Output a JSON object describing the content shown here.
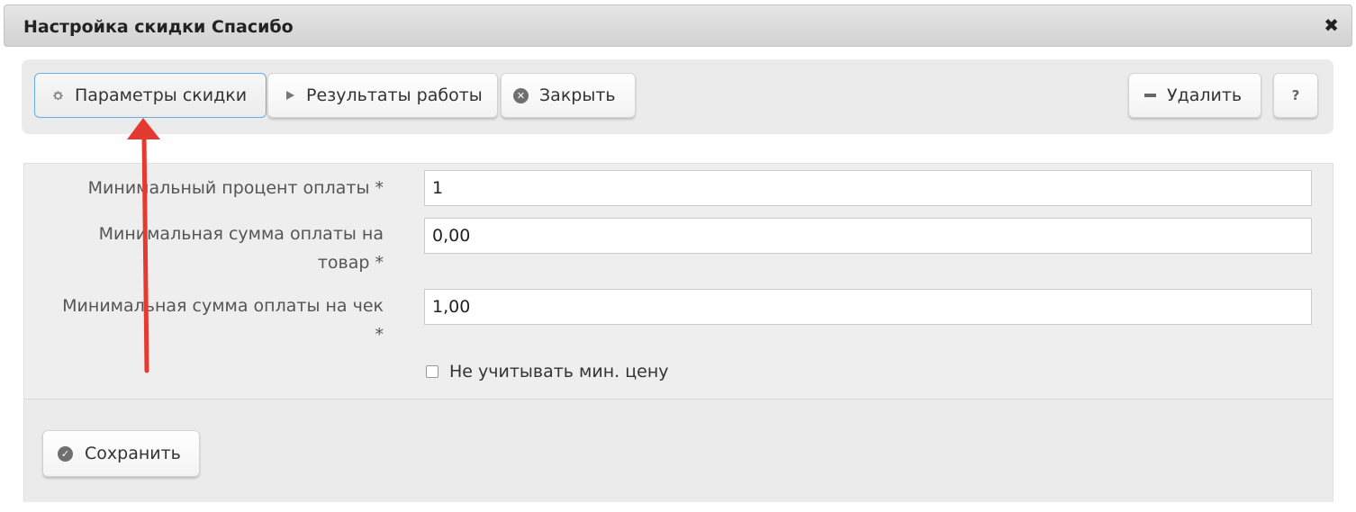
{
  "window": {
    "title": "Настройка скидки Спасибо",
    "close_symbol": "✖"
  },
  "toolbar": {
    "buttons": [
      {
        "label": "Параметры скидки",
        "icon": "gear-icon",
        "active": true
      },
      {
        "label": "Результаты работы",
        "icon": "play-icon"
      },
      {
        "label": "Закрыть",
        "icon": "close-circle-icon"
      }
    ],
    "delete_label": "Удалить",
    "help_label": "?"
  },
  "form": {
    "fields": [
      {
        "label_line1": "Минимальный процент оплаты *",
        "value": "1"
      },
      {
        "label_line1": "Минимальная сумма оплаты на",
        "label_line2": "товар *",
        "value": "0,00"
      },
      {
        "label_line1": "Минимальная сумма оплаты на чек",
        "label_line2": "*",
        "value": "1,00"
      }
    ],
    "checkbox_label": "Не учитывать мин. цену",
    "checkbox_checked": false
  },
  "footer": {
    "save_label": "Сохранить"
  },
  "colors": {
    "annotation_arrow": "#e53a2f"
  }
}
